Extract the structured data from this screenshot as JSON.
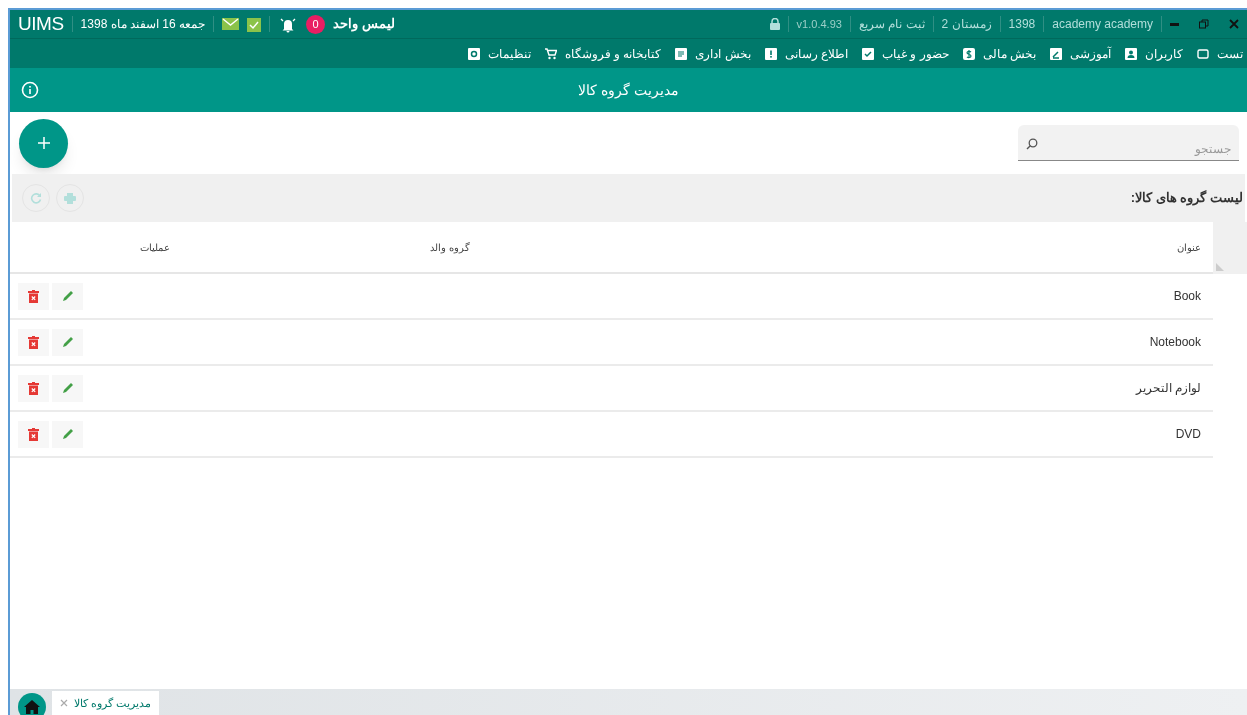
{
  "title_bar": {
    "logo": "UIMS",
    "date": "جمعه 16 اسفند ماه 1398",
    "notifications": "0",
    "unit": "لیمس واحد",
    "version": "v1.0.4.93",
    "quick_register": "ثبت نام سریع",
    "term": "زمستان 2",
    "year": "1398",
    "user": "academy academy"
  },
  "menu": [
    {
      "label": "تست"
    },
    {
      "label": "کاربران"
    },
    {
      "label": "آموزشی"
    },
    {
      "label": "بخش مالی"
    },
    {
      "label": "حضور و غیاب"
    },
    {
      "label": "اطلاع رسانی"
    },
    {
      "label": "بخش اداری"
    },
    {
      "label": "کتابخانه و فروشگاه"
    },
    {
      "label": "تنظیمات"
    }
  ],
  "page_title": "مدیریت گروه کالا",
  "search": {
    "placeholder": "جستجو"
  },
  "list_title": "لیست گروه های کالا:",
  "table": {
    "columns": [
      "عنوان",
      "گروه والد",
      "عملیات"
    ],
    "rows": [
      {
        "title": "Book"
      },
      {
        "title": "Notebook"
      },
      {
        "title": "لوازم التحریر"
      },
      {
        "title": "DVD"
      }
    ]
  },
  "tabs": [
    {
      "label": "مدیریت گروه کالا",
      "selected": true
    }
  ]
}
